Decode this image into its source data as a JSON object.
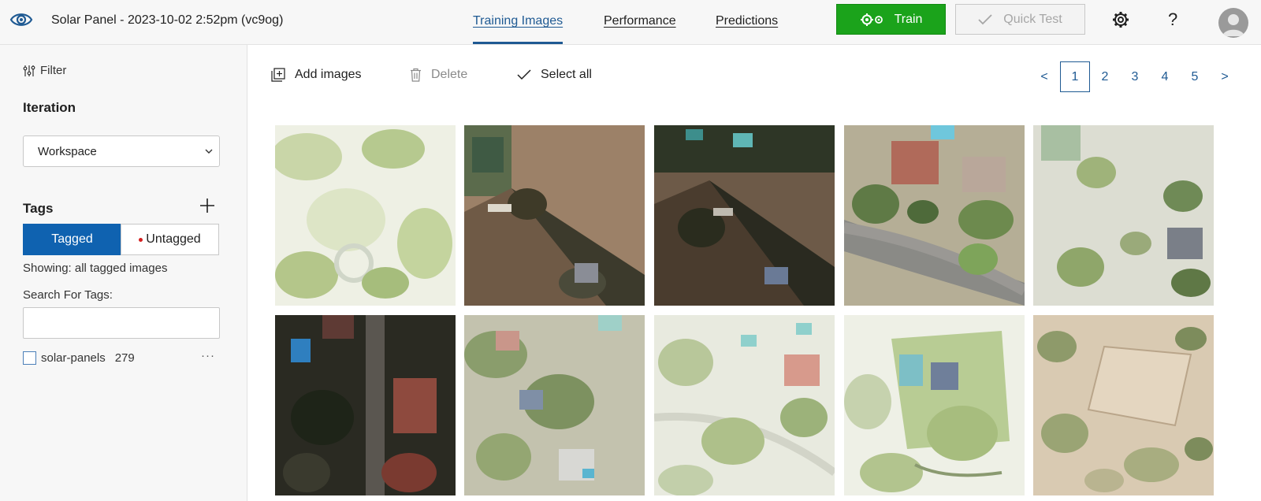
{
  "header": {
    "project_title": "Solar Panel - 2023-10-02 2:52pm (vc9og)",
    "tabs": [
      {
        "label": "Training Images",
        "active": true
      },
      {
        "label": "Performance",
        "active": false
      },
      {
        "label": "Predictions",
        "active": false
      }
    ],
    "train_label": "Train",
    "quick_test_label": "Quick Test",
    "help_label": "?",
    "colors": {
      "accent": "#1f5a93",
      "train": "#1ba31b",
      "tagged": "#0f62b0"
    }
  },
  "sidebar": {
    "filter_label": "Filter",
    "iteration_label": "Iteration",
    "iteration_value": "Workspace",
    "tags_label": "Tags",
    "tagged_label": "Tagged",
    "untagged_label": "Untagged",
    "showing_text": "Showing: all tagged images",
    "search_label": "Search For Tags:",
    "search_value": "",
    "tags": [
      {
        "name": "solar-panels",
        "count": "279",
        "more": "···"
      }
    ]
  },
  "toolbar": {
    "add_images_label": "Add images",
    "delete_label": "Delete",
    "select_all_label": "Select all"
  },
  "pagination": {
    "prev": "<",
    "pages": [
      "1",
      "2",
      "3",
      "4",
      "5"
    ],
    "current": "1",
    "next": ">"
  },
  "images": [
    {
      "name": "image-thumbnail-1",
      "tone": "pale-foliage"
    },
    {
      "name": "image-thumbnail-2",
      "tone": "dry-field"
    },
    {
      "name": "image-thumbnail-3",
      "tone": "dark-dry-field"
    },
    {
      "name": "image-thumbnail-4",
      "tone": "houses-road"
    },
    {
      "name": "image-thumbnail-5",
      "tone": "pale-estate"
    },
    {
      "name": "image-thumbnail-6",
      "tone": "dark-street"
    },
    {
      "name": "image-thumbnail-7",
      "tone": "hillside-homes"
    },
    {
      "name": "image-thumbnail-8",
      "tone": "pale-houses"
    },
    {
      "name": "image-thumbnail-9",
      "tone": "green-lawn"
    },
    {
      "name": "image-thumbnail-10",
      "tone": "sandy-lot"
    }
  ]
}
